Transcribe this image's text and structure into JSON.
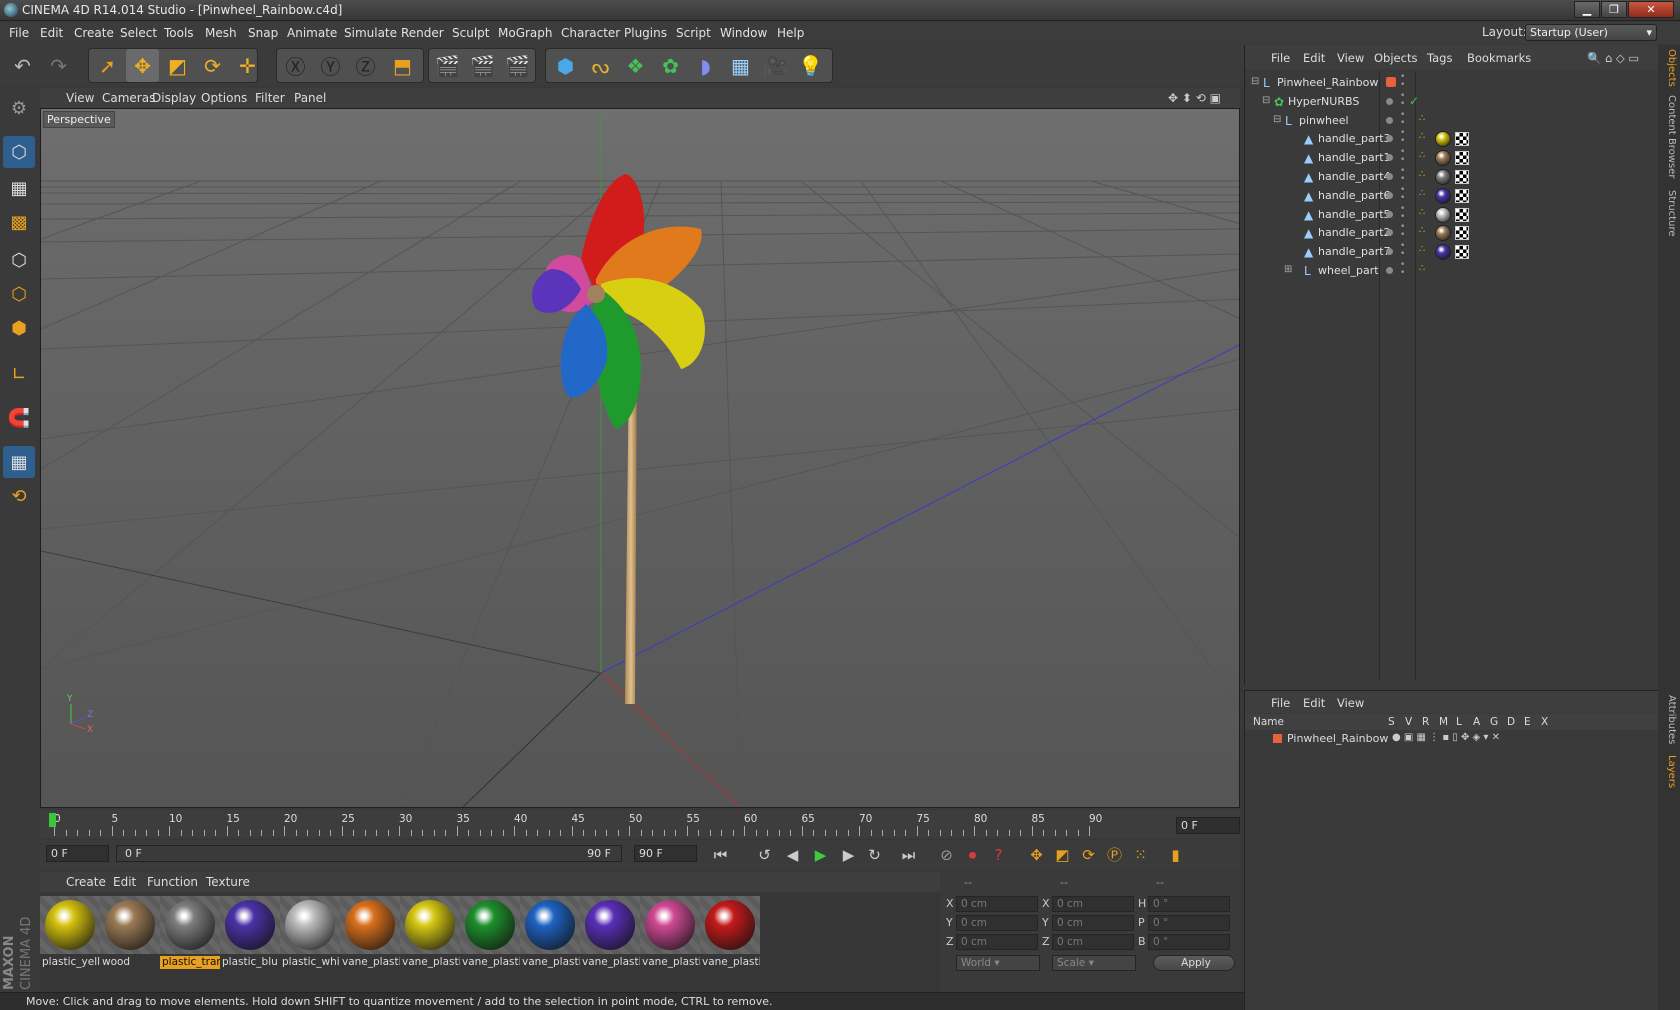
{
  "window": {
    "title": "CINEMA 4D R14.014 Studio - [Pinwheel_Rainbow.c4d]"
  },
  "menu": [
    "File",
    "Edit",
    "Create",
    "Select",
    "Tools",
    "Mesh",
    "Snap",
    "Animate",
    "Simulate",
    "Render",
    "Sculpt",
    "MoGraph",
    "Character",
    "Plugins",
    "Script",
    "Window",
    "Help"
  ],
  "layout": {
    "label": "Layout:",
    "value": "Startup (User)"
  },
  "viewport": {
    "menu": [
      "View",
      "Cameras",
      "Display",
      "Options",
      "Filter",
      "Panel"
    ],
    "label": "Perspective"
  },
  "timeline": {
    "ticks": [
      "0",
      "5",
      "10",
      "15",
      "20",
      "25",
      "30",
      "35",
      "40",
      "45",
      "50",
      "55",
      "60",
      "65",
      "70",
      "75",
      "80",
      "85",
      "90"
    ],
    "current_frame": "0 F"
  },
  "transport": {
    "start": "0 F",
    "range_start": "0 F",
    "range_end": "90 F",
    "end": "90 F"
  },
  "materials": {
    "menu": [
      "Create",
      "Edit",
      "Function",
      "Texture"
    ],
    "items": [
      {
        "name": "plastic_yell",
        "color": "#d4c20e"
      },
      {
        "name": "wood",
        "color": "#9b7b55"
      },
      {
        "name": "plastic_trar",
        "color": "#7d7d7d",
        "selected": true
      },
      {
        "name": "plastic_blu",
        "color": "#4b32a8"
      },
      {
        "name": "plastic_whi",
        "color": "#bdbdbd"
      },
      {
        "name": "vane_plasti",
        "color": "#d9701c"
      },
      {
        "name": "vane_plasti",
        "color": "#d6c813"
      },
      {
        "name": "vane_plasti",
        "color": "#1e8f2c"
      },
      {
        "name": "vane_plasti",
        "color": "#1e63c2"
      },
      {
        "name": "vane_plasti",
        "color": "#5a2fb8"
      },
      {
        "name": "vane_plasti",
        "color": "#cf4a95"
      },
      {
        "name": "vane_plasti",
        "color": "#c41a1a"
      }
    ]
  },
  "coords": {
    "headers": [
      "--",
      "--",
      "--"
    ],
    "rows": [
      {
        "a": "X",
        "av": "0 cm",
        "b": "X",
        "bv": "0 cm",
        "c": "H",
        "cv": "0 °"
      },
      {
        "a": "Y",
        "av": "0 cm",
        "b": "Y",
        "bv": "0 cm",
        "c": "P",
        "cv": "0 °"
      },
      {
        "a": "Z",
        "av": "0 cm",
        "b": "Z",
        "bv": "0 cm",
        "c": "B",
        "cv": "0 °"
      }
    ],
    "mode1": "World",
    "mode2": "Scale",
    "apply": "Apply"
  },
  "objects": {
    "menu": [
      "File",
      "Edit",
      "View",
      "Objects",
      "Tags",
      "Bookmarks"
    ],
    "rows": [
      {
        "name": "Pinwheel_Rainbow",
        "indent": 0,
        "icon": "null-icon"
      },
      {
        "name": "HyperNURBS",
        "indent": 1,
        "icon": "hypernurbs-icon"
      },
      {
        "name": "pinwheel",
        "indent": 2,
        "icon": "null-icon"
      },
      {
        "name": "handle_part3",
        "indent": 3,
        "icon": "polygon-icon",
        "mat": "#d4c20e"
      },
      {
        "name": "handle_part1",
        "indent": 3,
        "icon": "polygon-icon",
        "mat": "#9b7b55"
      },
      {
        "name": "handle_part4",
        "indent": 3,
        "icon": "polygon-icon",
        "mat": "#7d7d7d"
      },
      {
        "name": "handle_part6",
        "indent": 3,
        "icon": "polygon-icon",
        "mat": "#4b32a8"
      },
      {
        "name": "handle_part5",
        "indent": 3,
        "icon": "polygon-icon",
        "mat": "#bdbdbd"
      },
      {
        "name": "handle_part2",
        "indent": 3,
        "icon": "polygon-icon",
        "mat": "#9b7b55"
      },
      {
        "name": "handle_part7",
        "indent": 3,
        "icon": "polygon-icon",
        "mat": "#4b32a8"
      },
      {
        "name": "wheel_part",
        "indent": 3,
        "icon": "null-icon"
      }
    ]
  },
  "layers": {
    "menu": [
      "File",
      "Edit",
      "View"
    ],
    "header": {
      "name": "Name",
      "cols": [
        "S",
        "V",
        "R",
        "M",
        "L",
        "A",
        "G",
        "D",
        "E",
        "X"
      ]
    },
    "row": "Pinwheel_Rainbow"
  },
  "rightTabs": [
    "Objects",
    "Content Browser",
    "Structure",
    "Attributes",
    "Layers"
  ],
  "status": "Move: Click and drag to move elements. Hold down SHIFT to quantize movement / add to the selection in point mode, CTRL to remove.",
  "brand": [
    "MAXON",
    "CINEMA 4D"
  ]
}
